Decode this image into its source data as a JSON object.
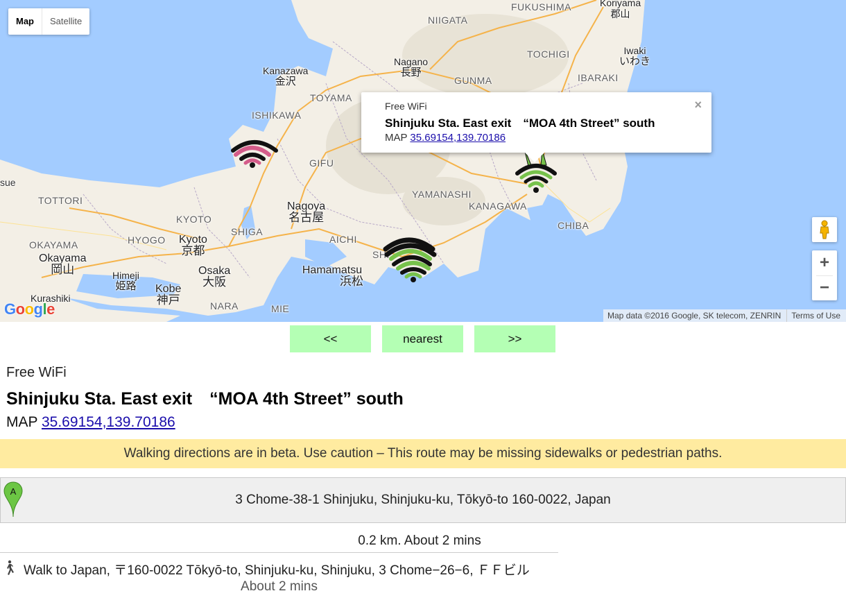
{
  "map": {
    "type_control": {
      "map_label": "Map",
      "satellite_label": "Satellite"
    },
    "attribution": {
      "data": "Map data ©2016 Google, SK telecom, ZENRIN",
      "terms": "Terms of Use"
    },
    "logo_text": "Google",
    "places": {
      "fukushima": "FUKUSHIMA",
      "koriyama_en": "Koriyama",
      "koriyama_jp": "郡山",
      "niigata": "NIIGATA",
      "nagano_en": "Nagano",
      "nagano_jp": "長野",
      "tochigi": "TOCHIGI",
      "iwaki_en": "Iwaki",
      "iwaki_jp": "いわき",
      "ibaraki": "IBARAKI",
      "kanazawa_en": "Kanazawa",
      "kanazawa_jp": "金沢",
      "toyama": "TOYAMA",
      "gunma": "GUNMA",
      "ishikawa": "ISHIKAWA",
      "gifu": "GIFU",
      "yamanashi": "YAMANASHI",
      "kanagawa": "KANAGAWA",
      "chiba": "CHIBA",
      "tottori": "TOTTORI",
      "kyoto_pref": "KYOTO",
      "nagoya_en": "Nagoya",
      "nagoya_jp": "名古屋",
      "shiga": "SHIGA",
      "aichi": "AICHI",
      "okayama_pref": "OKAYAMA",
      "hyogo": "HYOGO",
      "kyoto_en": "Kyoto",
      "kyoto_jp": "京都",
      "okayama_en": "Okayama",
      "okayama_jp": "岡山",
      "osaka_en": "Osaka",
      "osaka_jp": "大阪",
      "himeji_en": "Himeji",
      "himeji_jp": "姫路",
      "hamamatsu_en": "Hamamatsu",
      "hamamatsu_jp": "浜松",
      "kobe_en": "Kobe",
      "kobe_jp": "神戸",
      "kurashiki": "Kurashiki",
      "nara": "NARA",
      "mie": "MIE",
      "shi": "SHI",
      "sue": "sue"
    },
    "infowindow": {
      "category": "Free WiFi",
      "title": "Shinjuku Sta. East exit　“MOA 4th Street” south",
      "map_prefix": "MAP",
      "coords": "35.69154,139.70186",
      "close": "×"
    },
    "colors": {
      "water": "#a3ccff",
      "land": "#f3efe6",
      "wifi_green": "#77c24b",
      "wifi_pink": "#d45c8a"
    }
  },
  "nav": {
    "prev": "<<",
    "nearest": "nearest",
    "next": ">>"
  },
  "detail": {
    "category": "Free WiFi",
    "title": "Shinjuku Sta. East exit　“MOA 4th Street” south",
    "map_prefix": "MAP",
    "coords": "35.69154,139.70186"
  },
  "directions": {
    "warning": "Walking directions are in beta. Use caution – This route may be missing sidewalks or pedestrian paths.",
    "start_marker": "A",
    "start_address": "3 Chome-38-1 Shinjuku, Shinjuku-ku, Tōkyō-to 160-0022, Japan",
    "summary": "0.2 km. About 2 mins",
    "step_text": "Walk to Japan, 〒160-0022 Tōkyō-to, Shinjuku-ku, Shinjuku, 3 Chome−26−6, ＦＦビル",
    "step_time": "About 2 mins"
  }
}
